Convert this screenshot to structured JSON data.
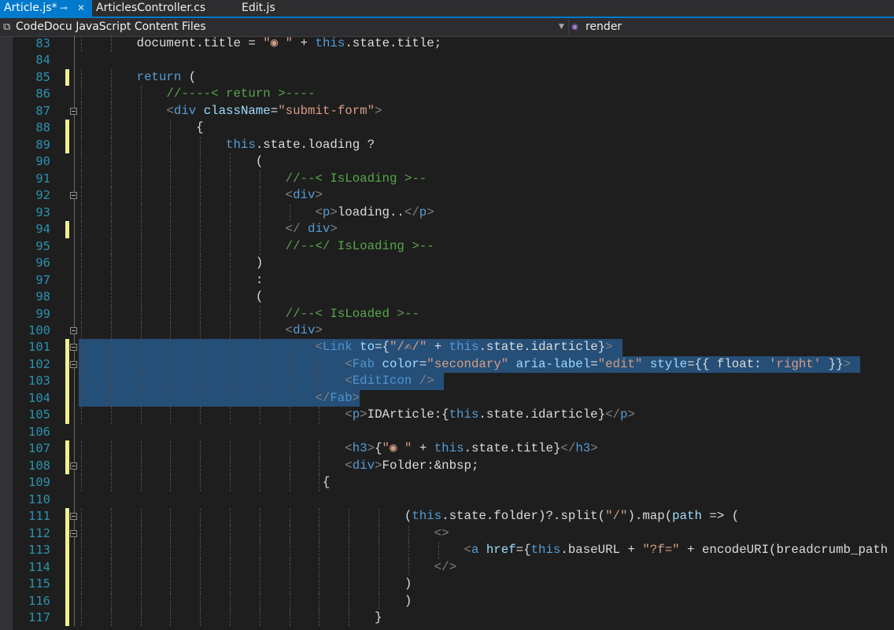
{
  "tabs": [
    {
      "label": "Article.js*",
      "active": true
    },
    {
      "label": "ArticlesController.cs",
      "active": false
    },
    {
      "label": "Edit.js",
      "active": false
    }
  ],
  "tab_icons": {
    "pin": "pin-icon",
    "close": "close-icon"
  },
  "navbar": {
    "project": "CodeDocu JavaScript Content Files",
    "member": "render"
  },
  "colors": {
    "background": "#1e1e1e",
    "accent": "#007acc",
    "line_number": "#2b91af",
    "selection": "#264f78",
    "change_marker": "#efef91"
  },
  "lines": [
    {
      "n": "83",
      "t": [
        [
          "t",
          "        document.title = "
        ],
        [
          "s",
          "\"◉ \""
        ],
        [
          "t",
          " + "
        ],
        [
          "k",
          "this"
        ],
        [
          "t",
          ".state.title;"
        ]
      ]
    },
    {
      "n": "84",
      "t": []
    },
    {
      "n": "85",
      "mark": true,
      "t": [
        [
          "k",
          "        return"
        ],
        [
          "t",
          " ("
        ]
      ]
    },
    {
      "n": "86",
      "t": [
        [
          "c",
          "            //----< return >----"
        ]
      ]
    },
    {
      "n": "87",
      "fold": true,
      "t": [
        [
          "b",
          "            <"
        ],
        [
          "h",
          "div"
        ],
        [
          "t",
          " "
        ],
        [
          "a",
          "className"
        ],
        [
          "t",
          "="
        ],
        [
          "s",
          "\"submit-form\""
        ],
        [
          "b",
          ">"
        ]
      ]
    },
    {
      "n": "88",
      "mark": true,
      "t": [
        [
          "t",
          "                {"
        ]
      ]
    },
    {
      "n": "89",
      "mark": true,
      "t": [
        [
          "k",
          "                    this"
        ],
        [
          "t",
          ".state.loading ?"
        ]
      ]
    },
    {
      "n": "90",
      "t": [
        [
          "t",
          "                        ("
        ]
      ]
    },
    {
      "n": "91",
      "t": [
        [
          "c",
          "                            //--< IsLoading >--"
        ]
      ]
    },
    {
      "n": "92",
      "fold": true,
      "t": [
        [
          "b",
          "                            <"
        ],
        [
          "h",
          "div"
        ],
        [
          "b",
          ">"
        ]
      ]
    },
    {
      "n": "93",
      "t": [
        [
          "b",
          "                                <"
        ],
        [
          "h",
          "p"
        ],
        [
          "b",
          ">"
        ],
        [
          "t",
          "loading.."
        ],
        [
          "b",
          "</"
        ],
        [
          "h",
          "p"
        ],
        [
          "b",
          ">"
        ]
      ]
    },
    {
      "n": "94",
      "mark": true,
      "t": [
        [
          "b",
          "                            </"
        ],
        [
          "t",
          " "
        ],
        [
          "h",
          "div"
        ],
        [
          "b",
          ">"
        ]
      ]
    },
    {
      "n": "95",
      "t": [
        [
          "c",
          "                            //--</ IsLoading >--"
        ]
      ]
    },
    {
      "n": "96",
      "t": [
        [
          "t",
          "                        )"
        ]
      ]
    },
    {
      "n": "97",
      "t": [
        [
          "t",
          "                        :"
        ]
      ]
    },
    {
      "n": "98",
      "t": [
        [
          "t",
          "                        ("
        ]
      ]
    },
    {
      "n": "99",
      "t": [
        [
          "c",
          "                            //--< IsLoaded >--"
        ]
      ]
    },
    {
      "n": "100",
      "fold": true,
      "t": [
        [
          "b",
          "                            <"
        ],
        [
          "h",
          "div"
        ],
        [
          "b",
          ">"
        ]
      ]
    },
    {
      "n": "101",
      "mark": true,
      "fold": true,
      "sel": "full",
      "t": [
        [
          "b",
          "                                <"
        ],
        [
          "g",
          "Link"
        ],
        [
          "t",
          " "
        ],
        [
          "a",
          "to"
        ],
        [
          "t",
          "={"
        ],
        [
          "s",
          "\"/✍/\""
        ],
        [
          "t",
          " + "
        ],
        [
          "k",
          "this"
        ],
        [
          "t",
          ".state.idarticle}"
        ],
        [
          "b",
          ">"
        ]
      ]
    },
    {
      "n": "102",
      "mark": true,
      "fold": true,
      "sel": "full",
      "t": [
        [
          "b",
          "                                    <"
        ],
        [
          "g",
          "Fab"
        ],
        [
          "t",
          " "
        ],
        [
          "a",
          "color"
        ],
        [
          "t",
          "="
        ],
        [
          "s",
          "\"secondary\""
        ],
        [
          "t",
          " "
        ],
        [
          "a",
          "aria-label"
        ],
        [
          "t",
          "="
        ],
        [
          "s",
          "\"edit\""
        ],
        [
          "t",
          " "
        ],
        [
          "a",
          "style"
        ],
        [
          "t",
          "={{ float: "
        ],
        [
          "s",
          "'right'"
        ],
        [
          "t",
          " }}"
        ],
        [
          "b",
          ">"
        ]
      ]
    },
    {
      "n": "103",
      "mark": true,
      "sel": "full",
      "t": [
        [
          "b",
          "                                    <"
        ],
        [
          "g",
          "EditIcon"
        ],
        [
          "t",
          " "
        ],
        [
          "b",
          "/>"
        ]
      ]
    },
    {
      "n": "104",
      "mark": true,
      "sel": "partial",
      "t": [
        [
          "b",
          "                                </"
        ],
        [
          "g",
          "Fab"
        ],
        [
          "b",
          ">"
        ]
      ]
    },
    {
      "n": "105",
      "mark": true,
      "t": [
        [
          "b",
          "                                    <"
        ],
        [
          "h",
          "p"
        ],
        [
          "b",
          ">"
        ],
        [
          "t",
          "IDArticle:{"
        ],
        [
          "k",
          "this"
        ],
        [
          "t",
          ".state.idarticle}"
        ],
        [
          "b",
          "</"
        ],
        [
          "h",
          "p"
        ],
        [
          "b",
          ">"
        ]
      ]
    },
    {
      "n": "106",
      "t": []
    },
    {
      "n": "107",
      "mark": true,
      "t": [
        [
          "b",
          "                                    <"
        ],
        [
          "h",
          "h3"
        ],
        [
          "b",
          ">"
        ],
        [
          "t",
          "{"
        ],
        [
          "s",
          "\"◉ \""
        ],
        [
          "t",
          " + "
        ],
        [
          "k",
          "this"
        ],
        [
          "t",
          ".state.title}"
        ],
        [
          "b",
          "</"
        ],
        [
          "h",
          "h3"
        ],
        [
          "b",
          ">"
        ]
      ]
    },
    {
      "n": "108",
      "mark": true,
      "fold": true,
      "t": [
        [
          "b",
          "                                    <"
        ],
        [
          "h",
          "div"
        ],
        [
          "b",
          ">"
        ],
        [
          "t",
          "Folder:&nbsp;"
        ]
      ]
    },
    {
      "n": "109",
      "t": [
        [
          "t",
          "                                 {"
        ]
      ]
    },
    {
      "n": "110",
      "t": []
    },
    {
      "n": "111",
      "mark": true,
      "fold": true,
      "t": [
        [
          "t",
          "                                            ("
        ],
        [
          "k",
          "this"
        ],
        [
          "t",
          ".state.folder)?.split("
        ],
        [
          "s",
          "\"/\""
        ],
        [
          "t",
          ").map("
        ],
        [
          "a",
          "path"
        ],
        [
          "t",
          " => ("
        ]
      ]
    },
    {
      "n": "112",
      "mark": true,
      "fold": true,
      "t": [
        [
          "b",
          "                                                <>"
        ]
      ]
    },
    {
      "n": "113",
      "mark": true,
      "t": [
        [
          "b",
          "                                                    <"
        ],
        [
          "h",
          "a"
        ],
        [
          "t",
          " "
        ],
        [
          "a",
          "href"
        ],
        [
          "t",
          "={"
        ],
        [
          "k",
          "this"
        ],
        [
          "t",
          ".baseURL + "
        ],
        [
          "s",
          "\"?f=\""
        ],
        [
          "t",
          " + encodeURI(breadcrumb_path ="
        ]
      ]
    },
    {
      "n": "114",
      "mark": true,
      "t": [
        [
          "b",
          "                                                </>"
        ]
      ]
    },
    {
      "n": "115",
      "mark": true,
      "t": [
        [
          "t",
          "                                            )"
        ]
      ]
    },
    {
      "n": "116",
      "mark": true,
      "t": [
        [
          "t",
          "                                            )"
        ]
      ]
    },
    {
      "n": "117",
      "mark": true,
      "t": [
        [
          "t",
          "                                        }"
        ]
      ]
    }
  ]
}
